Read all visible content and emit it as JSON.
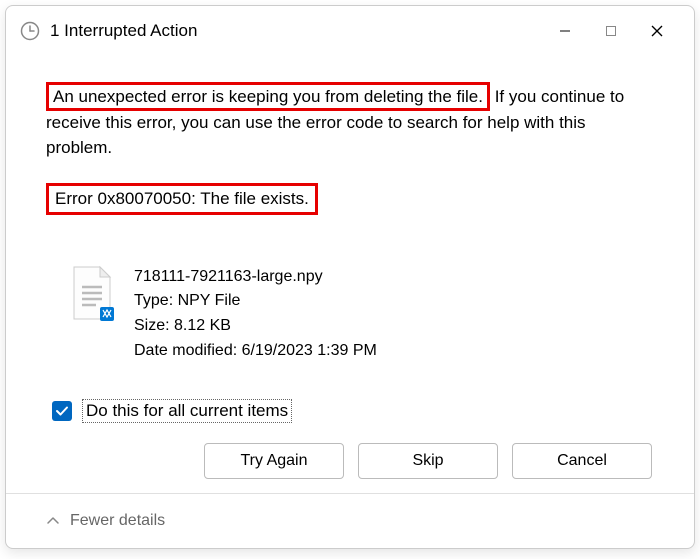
{
  "titlebar": {
    "title": "1 Interrupted Action"
  },
  "content": {
    "error_line1_highlight": "An unexpected error is keeping you from deleting the file.",
    "error_line1_rest": " If you continue to receive this error, you can use the error code to search for help with this problem.",
    "error_code": "Error 0x80070050: The file exists."
  },
  "file": {
    "name": "718111-7921163-large.npy",
    "type_label": "Type: ",
    "type_value": "NPY File",
    "size_label": "Size: ",
    "size_value": "8.12 KB",
    "modified_label": "Date modified: ",
    "modified_value": "6/19/2023 1:39 PM"
  },
  "checkbox": {
    "label": "Do this for all current items",
    "checked": true
  },
  "buttons": {
    "try_again": "Try Again",
    "skip": "Skip",
    "cancel": "Cancel"
  },
  "footer": {
    "fewer_details": "Fewer details"
  }
}
